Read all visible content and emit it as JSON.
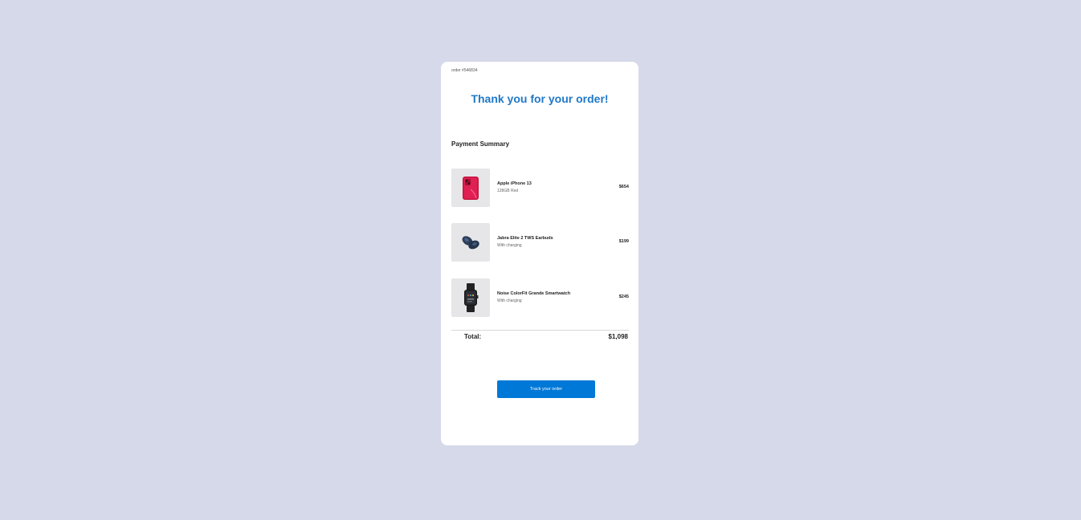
{
  "order": {
    "number_label": "order #546834"
  },
  "header": {
    "title": "Thank you for your order!"
  },
  "summary": {
    "heading": "Payment Summary",
    "items": [
      {
        "name": "Apple iPhone 13",
        "description": "128GB Red",
        "price": "$654",
        "icon": "phone-image"
      },
      {
        "name": "Jabra Elite 2 TWS Earbuds",
        "description": "With charging",
        "price": "$199",
        "icon": "earbuds-image"
      },
      {
        "name": "Noise ColorFit Grande Smartwatch",
        "description": "With charging",
        "price": "$245",
        "icon": "smartwatch-image"
      }
    ],
    "total_label": "Total:",
    "total_value": "$1,098"
  },
  "actions": {
    "track_label": "Track your order"
  },
  "colors": {
    "background": "#d6d9e9",
    "accent": "#1f78c8",
    "button": "#0078d7"
  }
}
